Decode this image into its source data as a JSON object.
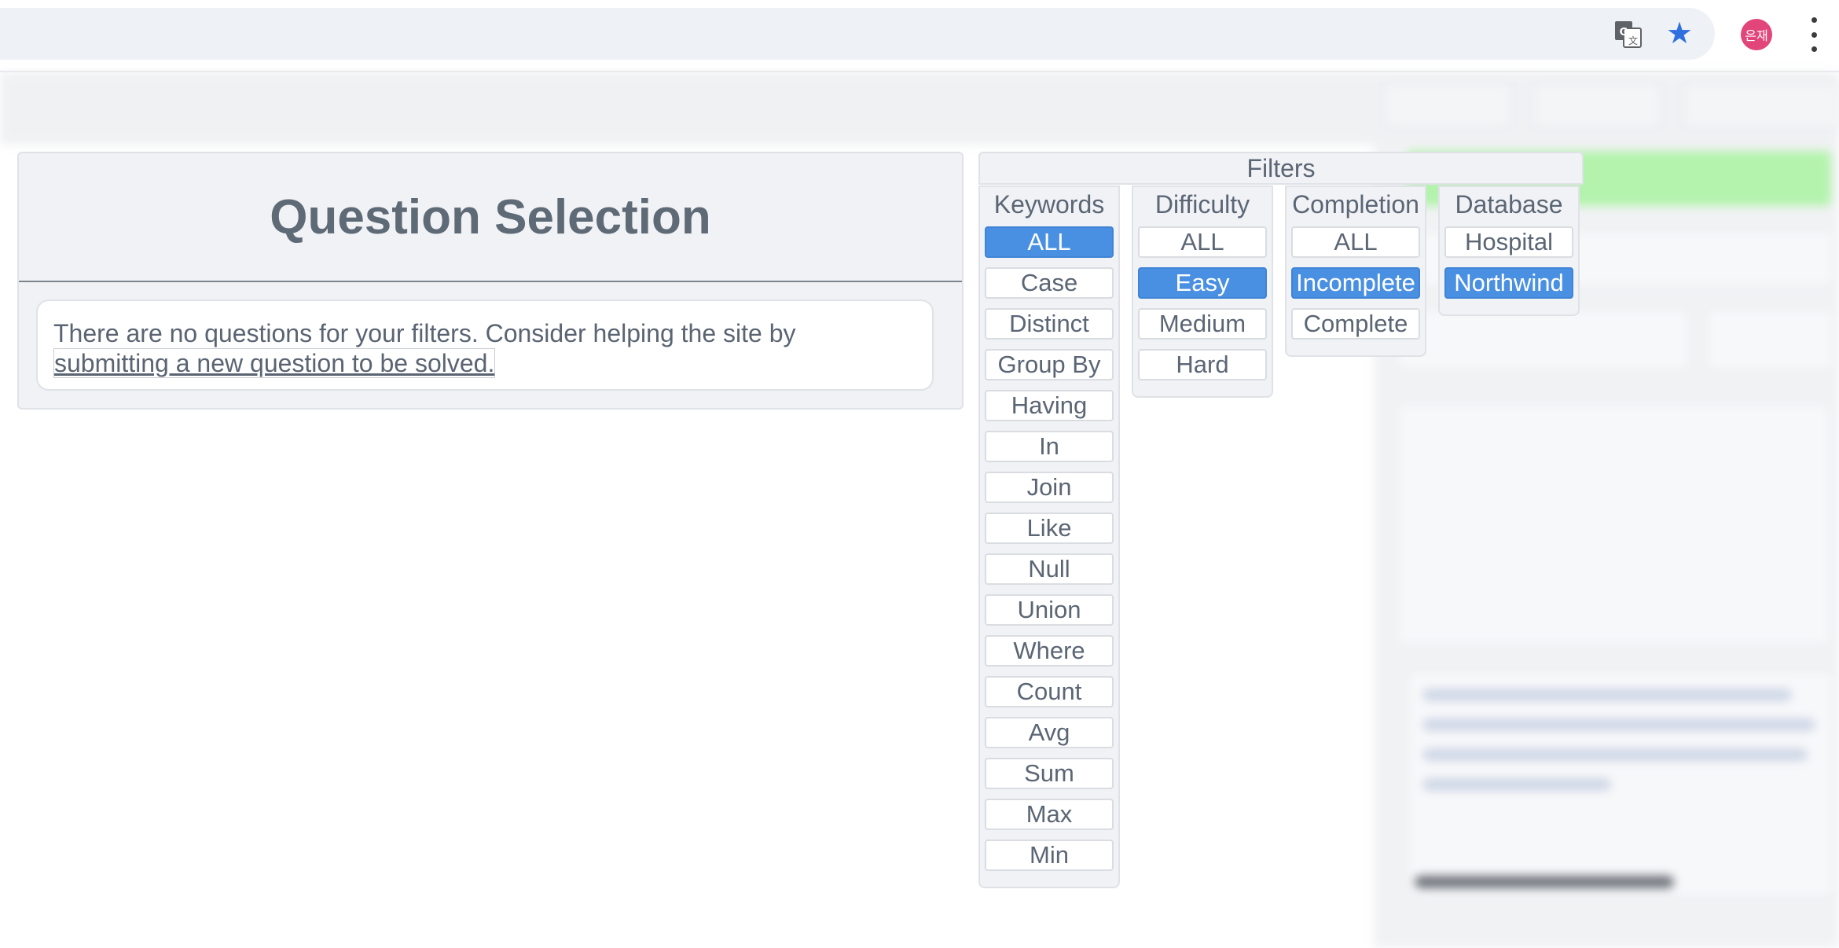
{
  "browser": {
    "icons": [
      "translate-icon",
      "star-icon",
      "avatar",
      "menu-icon"
    ],
    "avatar_text": "은재",
    "accent": "#2f6fe0",
    "avatar_color": "#e2457a"
  },
  "question_selection": {
    "title": "Question Selection",
    "message": "There are no questions for your filters. Consider helping the site by",
    "link_text": "submitting a new question to be solved."
  },
  "filters": {
    "title": "Filters",
    "selected_color": "#4a90e2",
    "columns": [
      {
        "title": "Keywords",
        "options": [
          "ALL",
          "Case",
          "Distinct",
          "Group By",
          "Having",
          "In",
          "Join",
          "Like",
          "Null",
          "Union",
          "Where",
          "Count",
          "Avg",
          "Sum",
          "Max",
          "Min"
        ],
        "selected": [
          "ALL"
        ]
      },
      {
        "title": "Difficulty",
        "options": [
          "ALL",
          "Easy",
          "Medium",
          "Hard"
        ],
        "selected": [
          "Easy"
        ]
      },
      {
        "title": "Completion",
        "options": [
          "ALL",
          "Incomplete",
          "Complete"
        ],
        "selected": [
          "Incomplete"
        ]
      },
      {
        "title": "Database",
        "options": [
          "Hospital",
          "Northwind"
        ],
        "selected": [
          "Northwind"
        ]
      }
    ]
  }
}
